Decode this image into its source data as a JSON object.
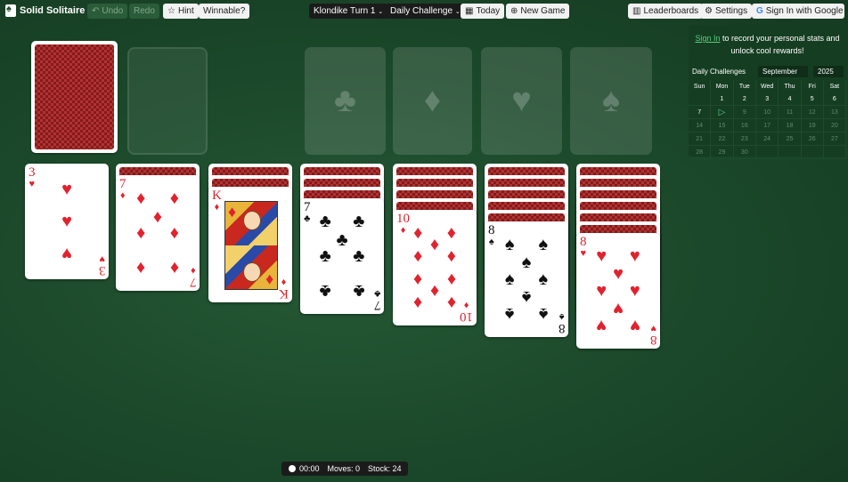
{
  "app": {
    "title": "Solid Solitaire"
  },
  "toolbar": {
    "undo": "Undo",
    "redo": "Redo",
    "hint": "Hint",
    "winnable": "Winnable?",
    "mode": "Klondike Turn 1",
    "challenge": "Daily Challenge",
    "today": "Today",
    "new_game": "New Game",
    "leaderboards": "Leaderboards",
    "settings": "Settings",
    "google": "Sign In with Google"
  },
  "panel": {
    "signin_link": "Sign In",
    "signin_text": " to record your personal stats and unlock cool rewards!",
    "daily_label": "Daily Challenges",
    "month": "September",
    "year": "2025",
    "weekdays": [
      "Sun",
      "Mon",
      "Tue",
      "Wed",
      "Thu",
      "Fri",
      "Sat"
    ],
    "weeks": [
      [
        "",
        "1",
        "2",
        "3",
        "4",
        "5",
        "6"
      ],
      [
        "7",
        "▷",
        "9",
        "10",
        "11",
        "12",
        "13"
      ],
      [
        "14",
        "15",
        "16",
        "17",
        "18",
        "19",
        "20"
      ],
      [
        "21",
        "22",
        "23",
        "24",
        "25",
        "26",
        "27"
      ],
      [
        "28",
        "29",
        "30",
        "",
        "",
        "",
        ""
      ]
    ]
  },
  "foundations": [
    "♣",
    "♦",
    "♥",
    "♠"
  ],
  "tableau": [
    {
      "hidden": 0,
      "rank": "3",
      "suit": "♥",
      "color": "red"
    },
    {
      "hidden": 1,
      "rank": "7",
      "suit": "♦",
      "color": "red"
    },
    {
      "hidden": 2,
      "rank": "K",
      "suit": "♦",
      "color": "red"
    },
    {
      "hidden": 3,
      "rank": "7",
      "suit": "♣",
      "color": "black"
    },
    {
      "hidden": 4,
      "rank": "10",
      "suit": "♦",
      "color": "red"
    },
    {
      "hidden": 5,
      "rank": "8",
      "suit": "♠",
      "color": "black"
    },
    {
      "hidden": 6,
      "rank": "8",
      "suit": "♥",
      "color": "red"
    }
  ],
  "status": {
    "time": "00:00",
    "moves": "Moves: 0",
    "stock": "Stock: 24"
  }
}
